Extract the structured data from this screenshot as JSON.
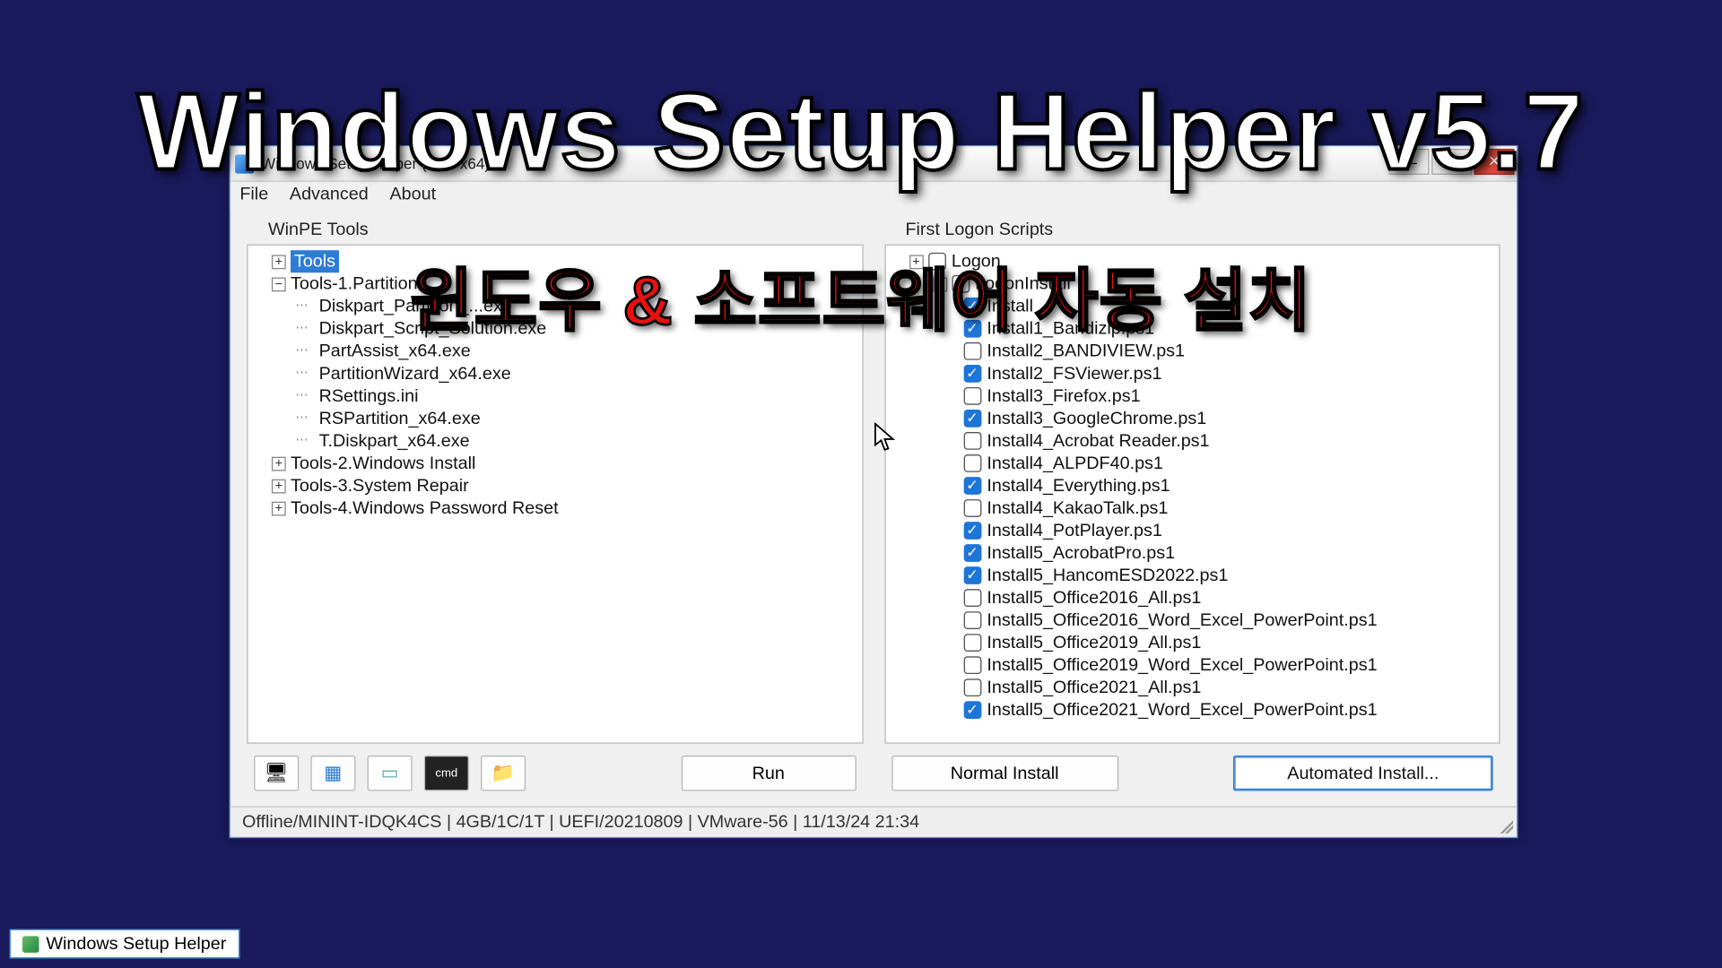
{
  "overlay": {
    "title": "Windows Setup Helper v5.7",
    "subtitle": "윈도우 & 소프트웨어 자동 설치"
  },
  "window": {
    "title": "Windows Setup Helper (v5.7 x64)"
  },
  "menu": {
    "file": "File",
    "advanced": "Advanced",
    "about": "About"
  },
  "left": {
    "label": "WinPE Tools",
    "tools_root": "Tools",
    "groups": {
      "g1": "Tools-1.Partition",
      "g2": "Tools-2.Windows Install",
      "g3": "Tools-3.System Repair",
      "g4": "Tools-4.Windows Password Reset"
    },
    "items": {
      "i0": "Diskpart_Partition_...exe",
      "i1": "Diskpart_Script_Solution.exe",
      "i2": "PartAssist_x64.exe",
      "i3": "PartitionWizard_x64.exe",
      "i4": "RSettings.ini",
      "i5": "RSPartition_x64.exe",
      "i6": "T.Diskpart_x64.exe"
    },
    "run": "Run"
  },
  "right": {
    "label": "First Logon Scripts",
    "root": "Logon",
    "sub1": "LogonInstall",
    "sub2": "Install",
    "items": [
      {
        "label": "Install1_Bandizip.ps1",
        "checked": true
      },
      {
        "label": "Install2_BANDIVIEW.ps1",
        "checked": false
      },
      {
        "label": "Install2_FSViewer.ps1",
        "checked": true
      },
      {
        "label": "Install3_Firefox.ps1",
        "checked": false
      },
      {
        "label": "Install3_GoogleChrome.ps1",
        "checked": true
      },
      {
        "label": "Install4_Acrobat Reader.ps1",
        "checked": false
      },
      {
        "label": "Install4_ALPDF40.ps1",
        "checked": false
      },
      {
        "label": "Install4_Everything.ps1",
        "checked": true
      },
      {
        "label": "Install4_KakaoTalk.ps1",
        "checked": false
      },
      {
        "label": "Install4_PotPlayer.ps1",
        "checked": true
      },
      {
        "label": "Install5_AcrobatPro.ps1",
        "checked": true
      },
      {
        "label": "Install5_HancomESD2022.ps1",
        "checked": true
      },
      {
        "label": "Install5_Office2016_All.ps1",
        "checked": false
      },
      {
        "label": "Install5_Office2016_Word_Excel_PowerPoint.ps1",
        "checked": false
      },
      {
        "label": "Install5_Office2019_All.ps1",
        "checked": false
      },
      {
        "label": "Install5_Office2019_Word_Excel_PowerPoint.ps1",
        "checked": false
      },
      {
        "label": "Install5_Office2021_All.ps1",
        "checked": false
      },
      {
        "label": "Install5_Office2021_Word_Excel_PowerPoint.ps1",
        "checked": true
      }
    ],
    "normal": "Normal Install",
    "auto": "Automated Install..."
  },
  "status": "Offline/MININT-IDQK4CS   |   4GB/1C/1T   |   UEFI/20210809   |   VMware-56    |   11/13/24 21:34",
  "taskbar": {
    "item": "Windows Setup Helper"
  },
  "icons": {
    "tool0": "🖥",
    "tool1": "▦",
    "tool2": "▭",
    "tool3": "cmd",
    "tool4": "📁"
  }
}
